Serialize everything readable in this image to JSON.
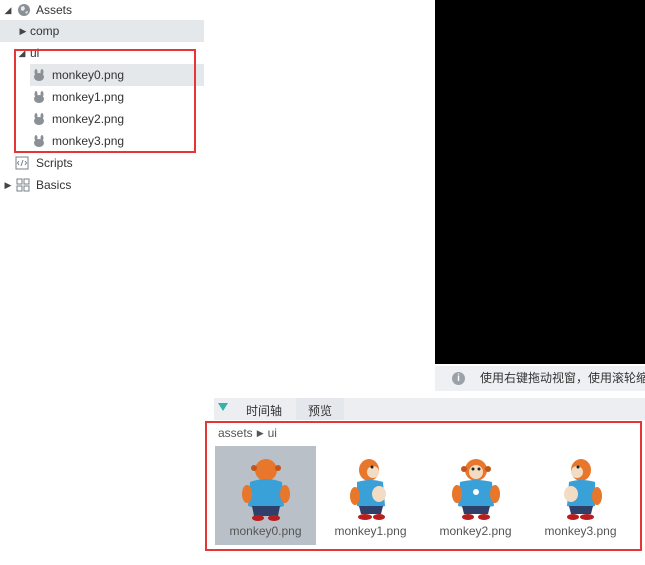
{
  "tree": {
    "assets_label": "Assets",
    "comp_label": "comp",
    "ui_label": "ui",
    "files": [
      "monkey0.png",
      "monkey1.png",
      "monkey2.png",
      "monkey3.png"
    ],
    "scripts_label": "Scripts",
    "basics_label": "Basics"
  },
  "hint": {
    "text": "使用右键拖动视窗，使用滚轮缩放"
  },
  "tabs": [
    {
      "label": "时间轴"
    },
    {
      "label": "预览"
    }
  ],
  "breadcrumb": {
    "root": "assets",
    "child": "ui"
  },
  "assets": [
    {
      "name": "monkey0.png",
      "selected": true
    },
    {
      "name": "monkey1.png",
      "selected": false
    },
    {
      "name": "monkey2.png",
      "selected": false
    },
    {
      "name": "monkey3.png",
      "selected": false
    }
  ],
  "colors": {
    "highlight": "#e53535",
    "scene": "#000000",
    "accent": "#32b2a8",
    "selection": "#b9c0c7"
  }
}
